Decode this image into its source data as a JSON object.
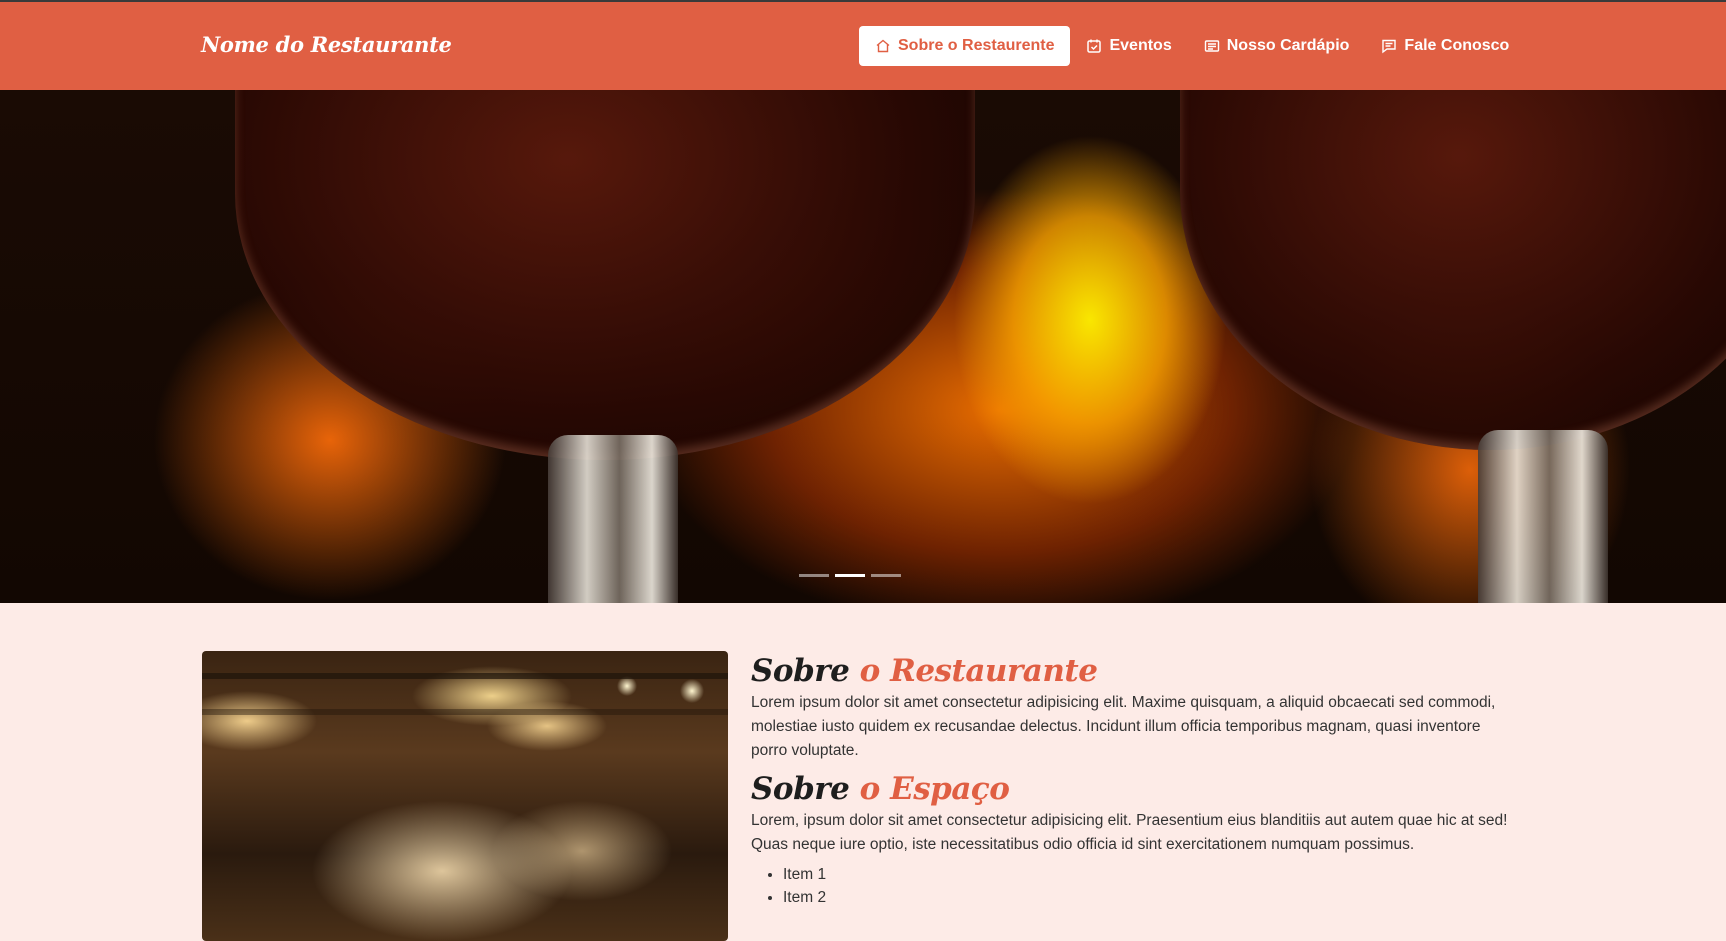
{
  "brand": "Nome do Restaurante",
  "nav": [
    {
      "label": "Sobre o Restaurente",
      "icon": "home-icon",
      "active": true
    },
    {
      "label": "Eventos",
      "icon": "calendar-icon"
    },
    {
      "label": "Nosso Cardápio",
      "icon": "menu-card-icon"
    },
    {
      "label": "Fale Conosco",
      "icon": "chat-icon"
    }
  ],
  "carousel": {
    "slides": 3,
    "active_index": 1
  },
  "about": {
    "title_main": "Sobre",
    "title_accent": "o Restaurante",
    "text": "Lorem ipsum dolor sit amet consectetur adipisicing elit. Maxime quisquam, a aliquid obcaecati sed commodi, molestiae iusto quidem ex recusandae delectus. Incidunt illum officia temporibus magnam, quasi inventore porro voluptate."
  },
  "space": {
    "title_main": "Sobre",
    "title_accent": "o Espaço",
    "text": "Lorem, ipsum dolor sit amet consectetur adipisicing elit. Praesentium eius blanditiis aut autem quae hic at sed! Quas neque iure optio, iste necessitatibus odio officia id sint exercitationem numquam possimus.",
    "items": [
      "Item 1",
      "Item 2"
    ]
  },
  "colors": {
    "accent": "#e05f43",
    "page_bg": "#fdebe7"
  }
}
